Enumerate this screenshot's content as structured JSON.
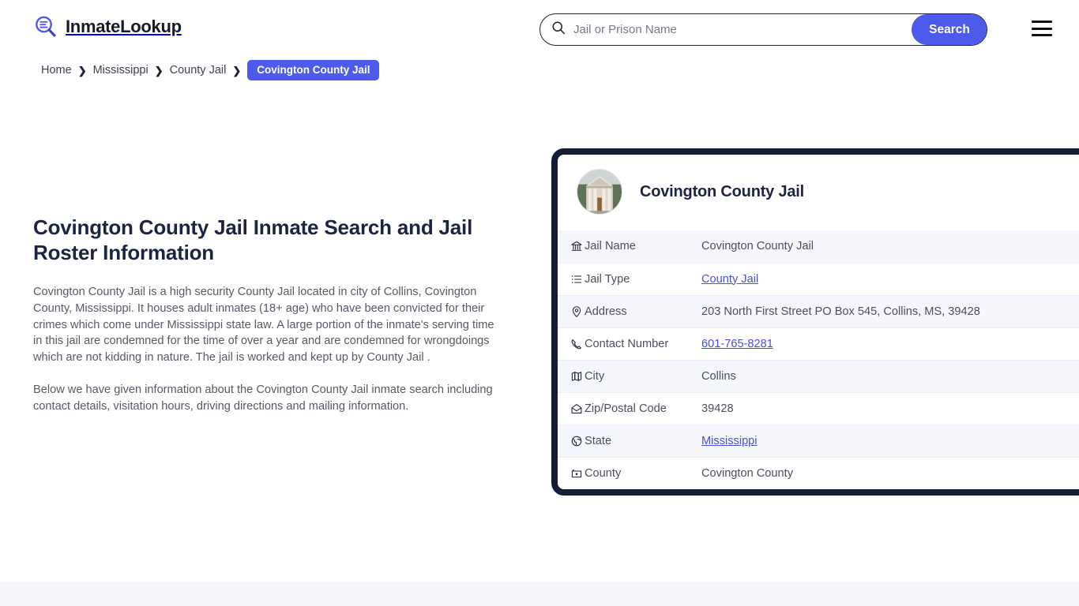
{
  "header": {
    "brand_name": "InmateLookup",
    "logo_icon": "magnifier-list-icon",
    "search": {
      "icon": "search-icon",
      "placeholder": "Jail or Prison Name",
      "value": "",
      "button_label": "Search"
    },
    "menu_icon": "hamburger-menu-icon",
    "accent_color": "#4c5bec"
  },
  "breadcrumb": {
    "items": [
      {
        "label": "Home",
        "current": false
      },
      {
        "label": "Mississippi",
        "current": false
      },
      {
        "label": "County Jail",
        "current": false
      },
      {
        "label": "Covington County Jail",
        "current": true
      }
    ],
    "separator": "❯"
  },
  "main": {
    "title": "Covington County Jail Inmate Search and Jail Roster Information",
    "paragraph_1": "Covington County Jail is a high security County Jail located in city of Collins, Covington County, Mississippi. It houses adult inmates (18+ age) who have been convicted for their crimes which come under Mississippi state law. A large portion of the inmate's serving time in this jail are condemned for the time of over a year and are condemned for wrongdoings which are not kidding in nature. The jail is worked and kept up by County Jail .",
    "paragraph_2": "Below we have given information about the Covington County Jail inmate search including contact details, visitation hours, driving directions and mailing information."
  },
  "card": {
    "avatar_icon": "courthouse-photo",
    "title": "Covington County Jail",
    "border_color": "#141d33",
    "rows": [
      {
        "icon": "bank-icon",
        "label": "Jail Name",
        "value": "Covington County Jail",
        "link": false
      },
      {
        "icon": "list-icon",
        "label": "Jail Type",
        "value": "County Jail",
        "link": true
      },
      {
        "icon": "map-pin-icon",
        "label": "Address",
        "value": "203 North First Street PO Box 545, Collins, MS, 39428",
        "link": false
      },
      {
        "icon": "phone-icon",
        "label": "Contact Number",
        "value": "601-765-8281",
        "link": true
      },
      {
        "icon": "map-icon",
        "label": "City",
        "value": "Collins",
        "link": false
      },
      {
        "icon": "envelope-icon",
        "label": "Zip/Postal Code",
        "value": "39428",
        "link": false
      },
      {
        "icon": "globe-icon",
        "label": "State",
        "value": "Mississippi",
        "link": true
      },
      {
        "icon": "county-pin-icon",
        "label": "County",
        "value": "Covington County",
        "link": false
      }
    ]
  }
}
